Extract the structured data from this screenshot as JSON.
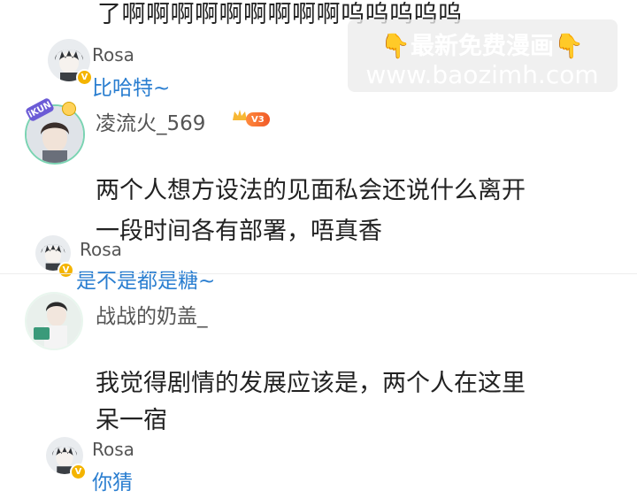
{
  "top_text": "了啊啊啊啊啊啊啊啊啊呜呜呜呜呜",
  "watermark": {
    "line1": "👇最新免费漫画👇",
    "line2": "www.baozimh.com"
  },
  "threads": [
    {
      "author": "Rosa",
      "reply": "比哈特~"
    },
    {
      "author": "凌流火_569",
      "level": "V3",
      "text_lines": [
        "两个人想方设法的见面私会还说什么离开",
        "一段时间各有部署，唔真香"
      ]
    },
    {
      "author": "Rosa",
      "reply": "是不是都是糖~"
    },
    {
      "author": "战战的奶盖_",
      "text_lines": [
        "我觉得剧情的发展应该是，两个人在这里",
        "呆一宿"
      ]
    },
    {
      "author": "Rosa",
      "reply": "你猜"
    }
  ],
  "avatar_tag": "iKUN",
  "colors": {
    "reply": "#2a7ed0",
    "name": "#555555",
    "verified": "#f4b400"
  }
}
